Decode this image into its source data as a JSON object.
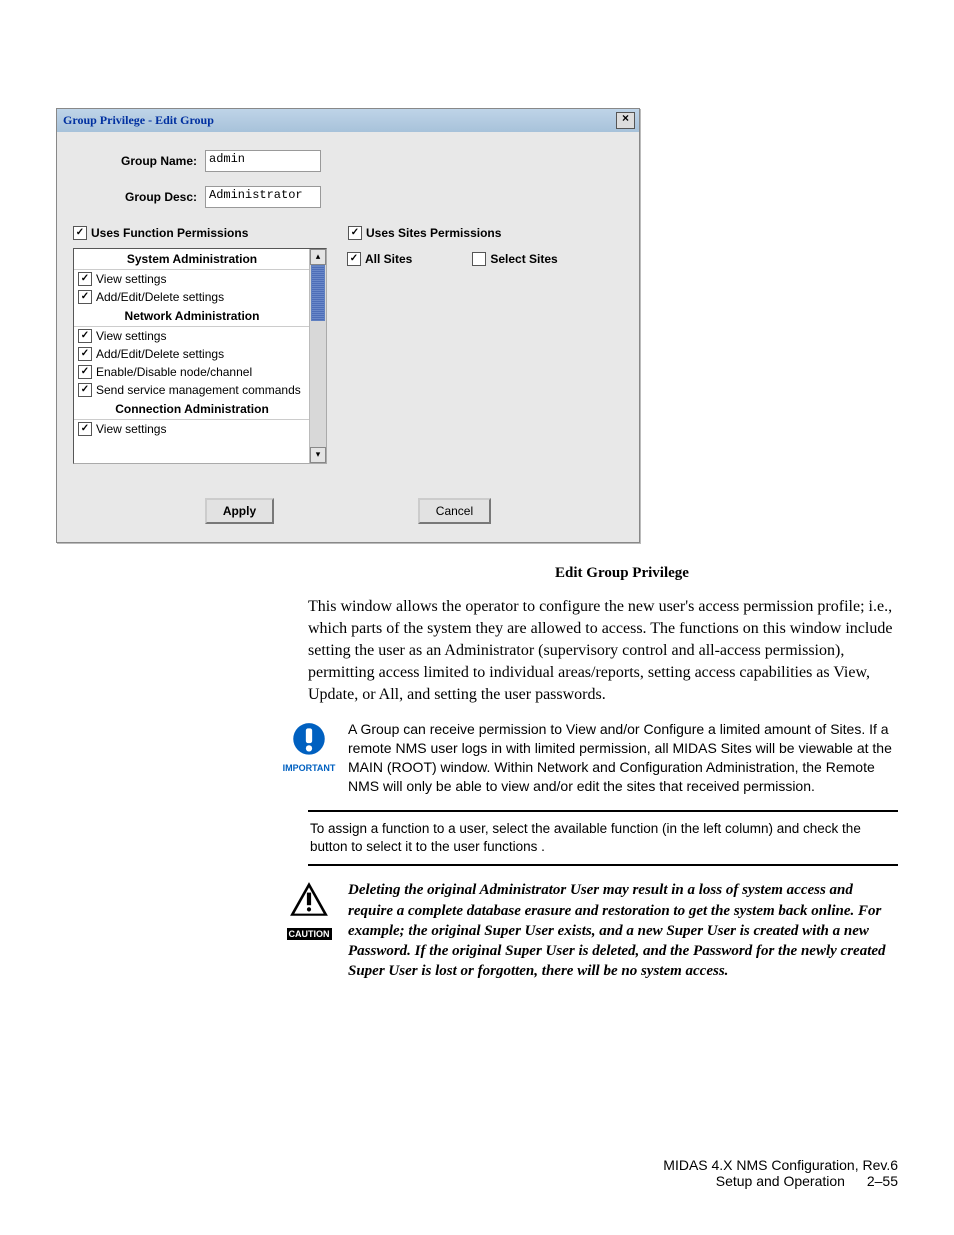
{
  "dialog": {
    "title": "Group Privilege - Edit Group",
    "group_name_label": "Group Name:",
    "group_name_value": "admin",
    "group_desc_label": "Group Desc:",
    "group_desc_value": "Administrator",
    "uses_function_label": "Uses Function Permissions",
    "uses_sites_label": "Uses Sites Permissions",
    "sections": {
      "sys_admin": "System Administration",
      "net_admin": "Network Administration",
      "conn_admin": "Connection Administration"
    },
    "items": {
      "view_settings": "View settings",
      "add_edit_delete": "Add/Edit/Delete settings",
      "enable_disable": "Enable/Disable node/channel",
      "send_service": "Send service management commands"
    },
    "all_sites": "All Sites",
    "select_sites": "Select Sites",
    "apply": "Apply",
    "cancel": "Cancel"
  },
  "caption": "Edit Group Privilege",
  "para1": "This window allows the operator to configure the new user's access permission profile; i.e., which parts of the system they are allowed to access. The functions on this window include setting the user as an Administrator (supervisory control and all-access permission), permitting access limited to individual areas/reports, setting access capabilities as View, Update, or All, and setting the user passwords.",
  "important": {
    "label": "IMPORTANT",
    "text": "A Group can receive permission to View and/or Configure a limited amount of Sites. If a remote NMS user logs in with limited permission, all MIDAS Sites will be viewable at the MAIN (ROOT) window. Within Network and Configuration Administration, the Remote NMS will only be able to view and/or edit the sites that received permission."
  },
  "assign_note": "To assign a function to a user, select the available function (in the left column) and check the button to select it to the user functions .",
  "caution": {
    "label": "CAUTION",
    "text": "Deleting the original Administrator User may result in a loss of system access and require a complete database erasure and restoration to get the system back online. For example; the original Super User exists, and a new Super User is created with a new Password. If the original Super User is deleted, and the Password for the newly created Super User is lost or forgotten, there will be no system access."
  },
  "footer": {
    "line1": "MIDAS 4.X NMS Configuration, Rev.6",
    "line2_a": "Setup and Operation",
    "line2_b": "2–55"
  }
}
